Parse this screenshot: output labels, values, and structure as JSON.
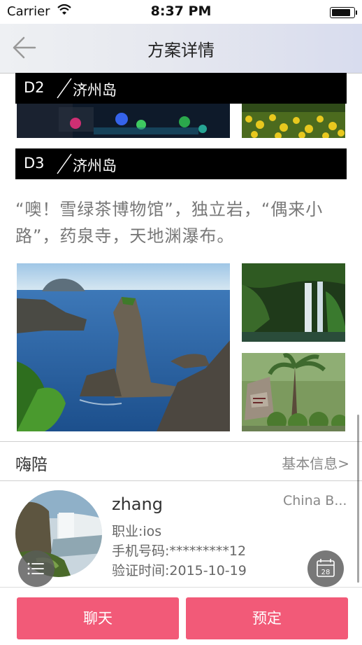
{
  "status_bar": {
    "carrier": "Carrier",
    "time": "8:37 PM",
    "battery_level": 0.92
  },
  "nav": {
    "title": "方案详情",
    "back_icon": "back-arrow-icon"
  },
  "itinerary": {
    "days": [
      {
        "code": "D2",
        "place": "济州岛"
      },
      {
        "code": "D3",
        "place": "济州岛"
      }
    ],
    "description": "“噢！雪绿茶博物馆”，独立岩，“偶来小路”，药泉寺，天地渊瀑布。"
  },
  "guide_section": {
    "title": "嗨陪",
    "link": "基本信息>"
  },
  "guide": {
    "name": "zhang",
    "location": "China B...",
    "job": "职业:ios",
    "phone": "手机号码:*********12",
    "verified": "验证时间:2015-10-19"
  },
  "floating_buttons": {
    "menu_icon": "menu-list-icon",
    "calendar_icon": "calendar-icon",
    "calendar_day": "28"
  },
  "actions": {
    "chat": "聊天",
    "book": "预定"
  },
  "colors": {
    "accent": "#f25a78",
    "day_bar": "#000000",
    "description_text": "#777777"
  }
}
